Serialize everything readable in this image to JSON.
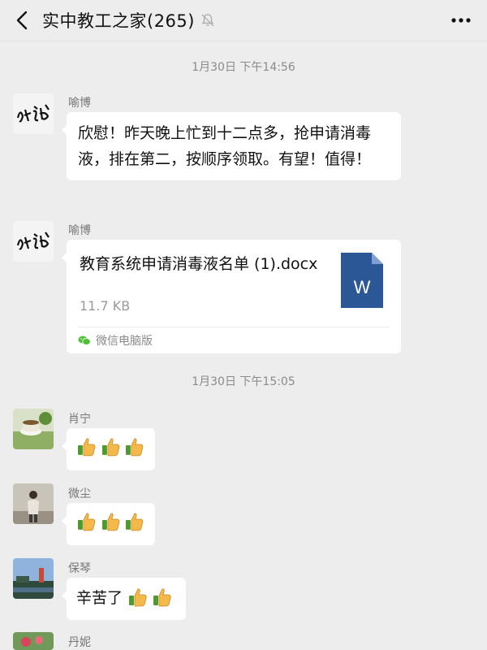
{
  "header": {
    "title": "实中教工之家(265)",
    "back_icon": "chevron-left-icon",
    "mute_icon": "bell-muted-icon",
    "more_icon": "more-dots-icon"
  },
  "messages": {
    "ts1": "1月30日 下午14:56",
    "m1": {
      "sender": "喻博",
      "text": "欣慰！昨天晚上忙到十二点多，抢申请消毒液，排在第二，按顺序领取。有望！值得！"
    },
    "m2": {
      "sender": "喻博",
      "file": {
        "name": "教育系统申请消毒液名单 (1).docx",
        "size": "11.7 KB",
        "source": "微信电脑版",
        "icon_letter": "W"
      }
    },
    "ts2": "1月30日 下午15:05",
    "m3": {
      "sender": "肖宁",
      "emoji": "thumbs-up x3"
    },
    "m4": {
      "sender": "微尘",
      "emoji": "thumbs-up x3"
    },
    "m5": {
      "sender": "保琴",
      "text": "辛苦了",
      "emoji": "thumbs-up x2"
    },
    "m6": {
      "sender": "丹妮"
    }
  },
  "colors": {
    "background": "#ededed",
    "bubble": "#ffffff",
    "word_blue": "#2b5797",
    "muted_text": "#8a8a8a"
  }
}
